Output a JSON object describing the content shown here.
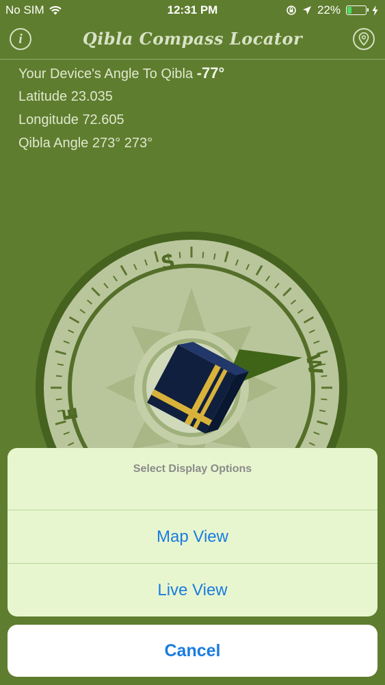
{
  "status": {
    "carrier": "No SIM",
    "time": "12:31 PM",
    "battery": "22%",
    "battery_level": 0.22
  },
  "header": {
    "title": "Qibla Compass Locator"
  },
  "info": {
    "angle_label": "Your Device's Angle To Qibla",
    "angle_value": "-77°",
    "latitude_label": "Latitude",
    "latitude_value": "23.035",
    "longitude_label": "Longitude",
    "longitude_value": "72.605",
    "qibla_label": "Qibla Angle",
    "qibla_value": "273° 273°"
  },
  "compass": {
    "labels": {
      "s": "S",
      "w": "W",
      "e": "E"
    }
  },
  "sheet": {
    "title": "Select Display Options",
    "options": [
      {
        "label": "Map View"
      },
      {
        "label": "Live View"
      }
    ],
    "cancel": "Cancel"
  },
  "colors": {
    "background": "#5f7d2e",
    "accent": "#1a7be0",
    "sheet": "#e8f6cf"
  }
}
